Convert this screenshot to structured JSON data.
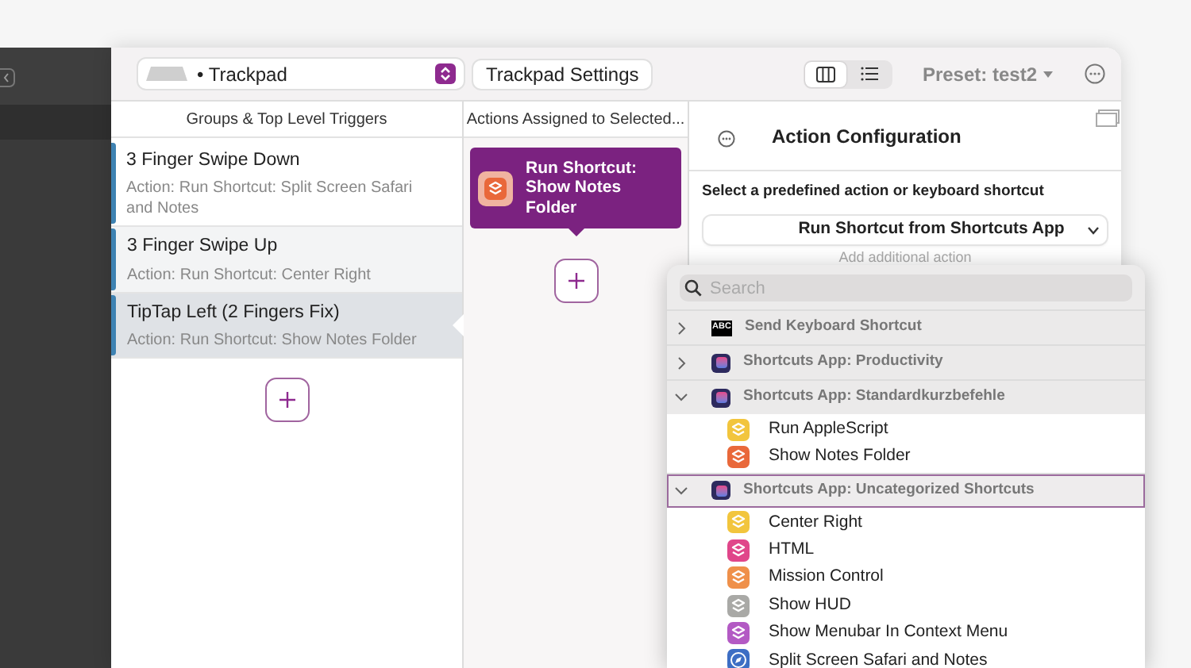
{
  "toolbar": {
    "device": "• Trackpad",
    "settings_button": "Trackpad Settings",
    "view_modes": [
      {
        "kind": "columns",
        "selected": true
      },
      {
        "kind": "list",
        "selected": false
      }
    ],
    "preset": "Preset: test2"
  },
  "headers": {
    "triggers": "Groups & Top Level Triggers",
    "actions": "Actions Assigned to Selected..."
  },
  "triggers": [
    {
      "name": "3 Finger Swipe Down",
      "action": "Action: Run Shortcut: Split Screen Safari and Notes",
      "selected": false
    },
    {
      "name": "3 Finger Swipe Up",
      "action": "Action: Run Shortcut: Center Right",
      "selected": false
    },
    {
      "name": "TipTap Left (2 Fingers Fix)",
      "action": "Action: Run Shortcut: Show Notes Folder",
      "selected": true
    }
  ],
  "actions": [
    {
      "label": "Run Shortcut: Show Notes Folder"
    }
  ],
  "config": {
    "title": "Action Configuration",
    "prompt": "Select a predefined action or keyboard shortcut",
    "selected_action": "Run Shortcut from Shortcuts App",
    "add_action": "Add additional action"
  },
  "picker": {
    "search_placeholder": "Search",
    "groups": [
      {
        "kind": "keyboard",
        "badge": "ABC",
        "label": "Send Keyboard Shortcut",
        "expanded": false,
        "selected": false
      },
      {
        "kind": "shortcuts",
        "label": "Shortcuts App: Productivity",
        "expanded": false,
        "selected": false
      },
      {
        "kind": "shortcuts",
        "label": "Shortcuts App: Standardkurzbefehle",
        "expanded": true,
        "selected": false,
        "children": [
          {
            "kind": "shortcut",
            "label": "Run AppleScript",
            "color": "#f2c53d"
          },
          {
            "kind": "shortcut",
            "label": "Show Notes Folder",
            "color": "#e9683a"
          }
        ]
      },
      {
        "kind": "shortcuts",
        "label": "Shortcuts App: Uncategorized Shortcuts",
        "expanded": true,
        "selected": true,
        "children": [
          {
            "kind": "shortcut",
            "label": "Center Right",
            "color": "#f2c53d"
          },
          {
            "kind": "shortcut",
            "label": "HTML",
            "color": "#e0468a"
          },
          {
            "kind": "shortcut",
            "label": "Mission Control",
            "color": "#ef904a"
          },
          {
            "kind": "shortcut",
            "label": "Show HUD",
            "color": "#a9a9a6"
          },
          {
            "kind": "shortcut",
            "label": "Show Menubar In Context Menu",
            "color": "#b35ac4"
          },
          {
            "kind": "compass",
            "label": "Split Screen Safari and Notes",
            "color": "#3d6ec4"
          }
        ]
      }
    ]
  }
}
